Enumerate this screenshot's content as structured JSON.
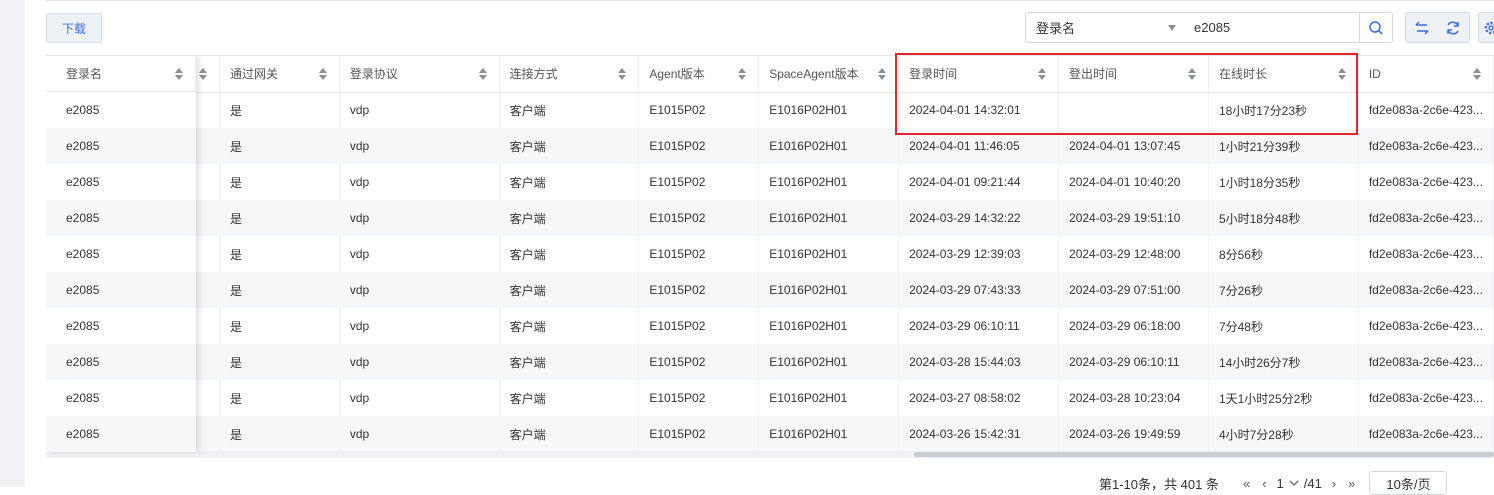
{
  "toolbar": {
    "download_label": "下载",
    "search_field_selected": "登录名",
    "search_value": "e2085"
  },
  "table": {
    "fixed_header": "登录名",
    "columns": [
      "通过网关",
      "登录协议",
      "连接方式",
      "Agent版本",
      "SpaceAgent版本",
      "登录时间",
      "登出时间",
      "在线时长",
      "ID"
    ],
    "rows": [
      {
        "login": "e2085",
        "gateway": "是",
        "protocol": "vdp",
        "conn": "客户端",
        "agent": "E1015P02",
        "space": "E1016P02H01",
        "login_time": "2024-04-01 14:32:01",
        "logout_time": "",
        "duration": "18小时17分23秒",
        "id": "fd2e083a-2c6e-423..."
      },
      {
        "login": "e2085",
        "gateway": "是",
        "protocol": "vdp",
        "conn": "客户端",
        "agent": "E1015P02",
        "space": "E1016P02H01",
        "login_time": "2024-04-01 11:46:05",
        "logout_time": "2024-04-01 13:07:45",
        "duration": "1小时21分39秒",
        "id": "fd2e083a-2c6e-423..."
      },
      {
        "login": "e2085",
        "gateway": "是",
        "protocol": "vdp",
        "conn": "客户端",
        "agent": "E1015P02",
        "space": "E1016P02H01",
        "login_time": "2024-04-01 09:21:44",
        "logout_time": "2024-04-01 10:40:20",
        "duration": "1小时18分35秒",
        "id": "fd2e083a-2c6e-423..."
      },
      {
        "login": "e2085",
        "gateway": "是",
        "protocol": "vdp",
        "conn": "客户端",
        "agent": "E1015P02",
        "space": "E1016P02H01",
        "login_time": "2024-03-29 14:32:22",
        "logout_time": "2024-03-29 19:51:10",
        "duration": "5小时18分48秒",
        "id": "fd2e083a-2c6e-423..."
      },
      {
        "login": "e2085",
        "gateway": "是",
        "protocol": "vdp",
        "conn": "客户端",
        "agent": "E1015P02",
        "space": "E1016P02H01",
        "login_time": "2024-03-29 12:39:03",
        "logout_time": "2024-03-29 12:48:00",
        "duration": "8分56秒",
        "id": "fd2e083a-2c6e-423..."
      },
      {
        "login": "e2085",
        "gateway": "是",
        "protocol": "vdp",
        "conn": "客户端",
        "agent": "E1015P02",
        "space": "E1016P02H01",
        "login_time": "2024-03-29 07:43:33",
        "logout_time": "2024-03-29 07:51:00",
        "duration": "7分26秒",
        "id": "fd2e083a-2c6e-423..."
      },
      {
        "login": "e2085",
        "gateway": "是",
        "protocol": "vdp",
        "conn": "客户端",
        "agent": "E1015P02",
        "space": "E1016P02H01",
        "login_time": "2024-03-29 06:10:11",
        "logout_time": "2024-03-29 06:18:00",
        "duration": "7分48秒",
        "id": "fd2e083a-2c6e-423..."
      },
      {
        "login": "e2085",
        "gateway": "是",
        "protocol": "vdp",
        "conn": "客户端",
        "agent": "E1015P02",
        "space": "E1016P02H01",
        "login_time": "2024-03-28 15:44:03",
        "logout_time": "2024-03-29 06:10:11",
        "duration": "14小时26分7秒",
        "id": "fd2e083a-2c6e-423..."
      },
      {
        "login": "e2085",
        "gateway": "是",
        "protocol": "vdp",
        "conn": "客户端",
        "agent": "E1015P02",
        "space": "E1016P02H01",
        "login_time": "2024-03-27 08:58:02",
        "logout_time": "2024-03-28 10:23:04",
        "duration": "1天1小时25分2秒",
        "id": "fd2e083a-2c6e-423..."
      },
      {
        "login": "e2085",
        "gateway": "是",
        "protocol": "vdp",
        "conn": "客户端",
        "agent": "E1015P02",
        "space": "E1016P02H01",
        "login_time": "2024-03-26 15:42:31",
        "logout_time": "2024-03-26 19:49:59",
        "duration": "4小时7分28秒",
        "id": "fd2e083a-2c6e-423..."
      }
    ]
  },
  "pagination": {
    "summary": "第1-10条，共 401 条",
    "first": "«",
    "prev": "‹",
    "current_page": "1",
    "total_pages": "/41",
    "next": "›",
    "last": "»",
    "page_size": "10条/页"
  },
  "colors": {
    "highlight_box": "#e0262a",
    "accent": "#3a6fd8"
  },
  "icons": {
    "search": "search-icon",
    "switch": "swap-icon",
    "refresh": "refresh-icon",
    "settings": "gear-icon"
  }
}
